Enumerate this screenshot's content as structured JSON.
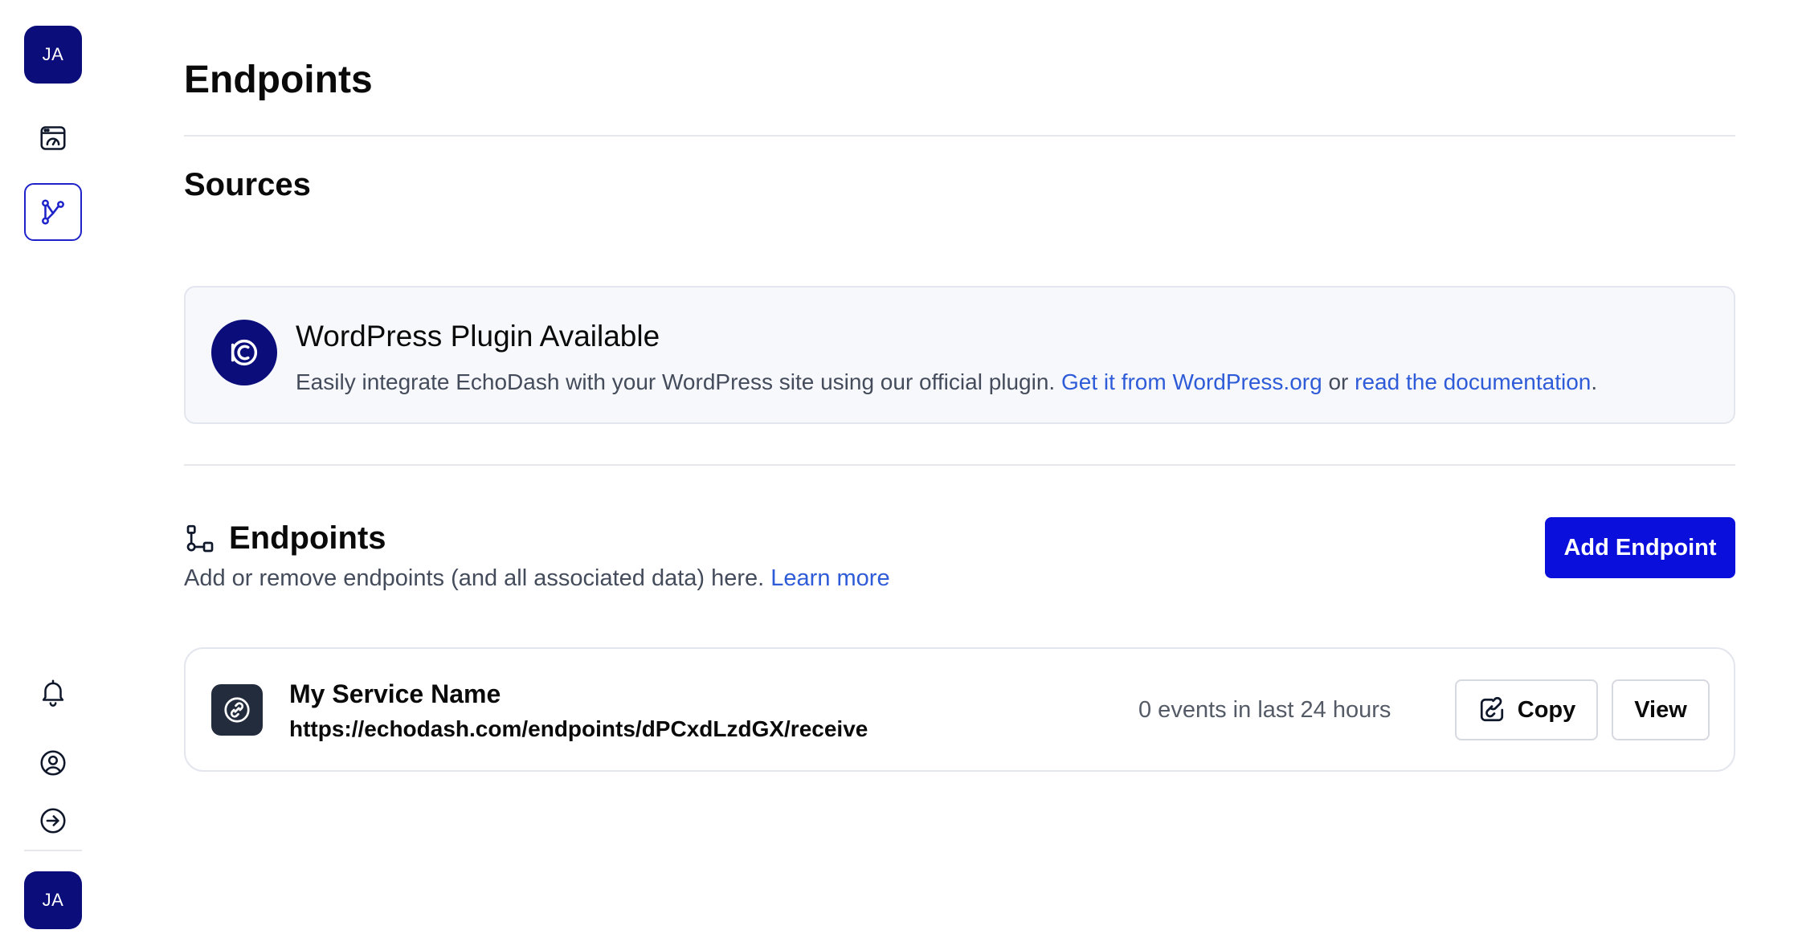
{
  "sidebar": {
    "user_initials": "JA",
    "nav": [
      {
        "name": "dashboard",
        "icon": "dashboard-icon"
      },
      {
        "name": "endpoints",
        "icon": "endpoints-branch-icon",
        "active": true
      }
    ],
    "bottom_nav": [
      {
        "name": "notifications",
        "icon": "bell-icon"
      },
      {
        "name": "account",
        "icon": "user-circle-icon"
      },
      {
        "name": "logout",
        "icon": "arrow-right-circle-icon"
      }
    ],
    "bottom_initials": "JA"
  },
  "page": {
    "title": "Endpoints",
    "sources_title": "Sources"
  },
  "plugin": {
    "title": "WordPress Plugin Available",
    "desc_prefix": "Easily integrate EchoDash with your WordPress site using our official plugin.",
    "link_get": "Get it from WordPress.org",
    "desc_or": "or",
    "link_docs": "read the documentation",
    "desc_suffix": "."
  },
  "endpoints_section": {
    "title": "Endpoints",
    "desc": "Add or remove endpoints (and all associated data) here.",
    "learn_more": "Learn more",
    "add_button": "Add Endpoint"
  },
  "endpoint": {
    "name": "My Service Name",
    "url": "https://echodash.com/endpoints/dPCxdLzdGX/receive",
    "events": "0 events in last 24 hours",
    "copy_label": "Copy",
    "view_label": "View"
  },
  "colors": {
    "brand": "#0b0d7a",
    "primary_button": "#0a0fdc",
    "link": "#2e5bd8"
  }
}
